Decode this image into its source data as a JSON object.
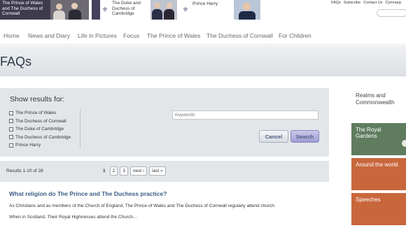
{
  "promos": [
    {
      "text": "The Prince of Wales and The Duchess of Cornwall"
    },
    {
      "text": "The Duke and Duchess of Cambridge"
    },
    {
      "text": "Prince Harry"
    }
  ],
  "utility": [
    "FAQs",
    "Subscribe",
    "Contact Us",
    "Cymraeg"
  ],
  "nav": [
    "Home",
    "News and Diary",
    "Life in Pictures",
    "Focus",
    "The Prince of Wales",
    "The Duchess of Cornwall",
    "For Children"
  ],
  "page_title": "FAQs",
  "filter": {
    "heading": "Show results for:",
    "options": [
      "The Prince of Wales",
      "The Duchess of Cornwall",
      "The Duke of Cambridge",
      "The Duchess of Cambridge",
      "Prince Harry"
    ],
    "keywords_placeholder": "Keywords",
    "cancel_label": "Cancel",
    "search_label": "Search"
  },
  "results": {
    "count": "Results 1-10 of 28",
    "pages": [
      "1",
      "2",
      "3"
    ],
    "next": "next ›",
    "last": "last »"
  },
  "article": {
    "title": "What religion do The Prince and The Duchess practice?",
    "p1": "As Christians and as members of the Church of England, The Prince of Wales and The Duchess of Cornwall regularly attend church.",
    "p2": "When in Scotland, Their Royal Highnesses attend the Church..."
  },
  "sidebar": {
    "heading": "Realms and Commonwealth",
    "tiles": [
      "The Royal Gardens",
      "Around the world",
      "Speeches"
    ]
  },
  "colors": {
    "link": "#3b5c86",
    "tile_green": "#5f7c5e",
    "tile_orange": "#c8673c",
    "panel": "#e3e6e9"
  }
}
